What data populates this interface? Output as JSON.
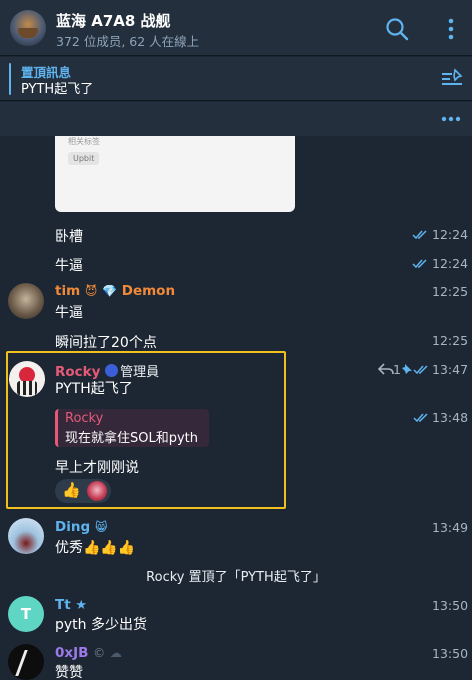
{
  "header": {
    "title": "蓝海 A7A8 战舰",
    "subtitle": "372 位成员, 62 人在線上"
  },
  "pinned": {
    "label": "置頂訊息",
    "text": "PYTH起飞了"
  },
  "image_card": {
    "faint_text": "相关标签",
    "tag": "Upbit"
  },
  "messages": [
    {
      "text": "卧槽",
      "time": "12:24"
    },
    {
      "text": "牛逼",
      "time": "12:24"
    },
    {
      "sender": "tim",
      "badge": "Demon",
      "text": "牛逼",
      "time": "12:25",
      "name_color": "#f08a3a"
    },
    {
      "text": "瞬间拉了20个点",
      "time": "12:25"
    },
    {
      "sender": "Rocky",
      "role": "管理員",
      "text": "PYTH起飞了",
      "reply_count": "1",
      "time": "13:47",
      "name_color": "#e65a78"
    },
    {
      "quote_name": "Rocky",
      "quote_text": "现在就拿住SOL和pyth",
      "time": "13:48"
    },
    {
      "text": "早上才刚刚说"
    },
    {
      "sender": "Ding",
      "text": "优秀👍👍👍",
      "time": "13:49",
      "name_color": "#5fb3ee"
    },
    {
      "sender": "Tt",
      "text": "pyth 多少出货",
      "time": "13:50",
      "name_color": "#5fb3ee",
      "avatar_letter": "T"
    },
    {
      "sender": "0xJB",
      "text": "赞赞",
      "time": "13:50",
      "name_color": "#9c7ae8"
    }
  ],
  "service_message": "Rocky 置頂了「PYTH起飞了」",
  "colors": {
    "accent": "#5fb3ee",
    "highlight": "#f2c01d",
    "background": "#1d2733",
    "header": "#232f3d"
  }
}
